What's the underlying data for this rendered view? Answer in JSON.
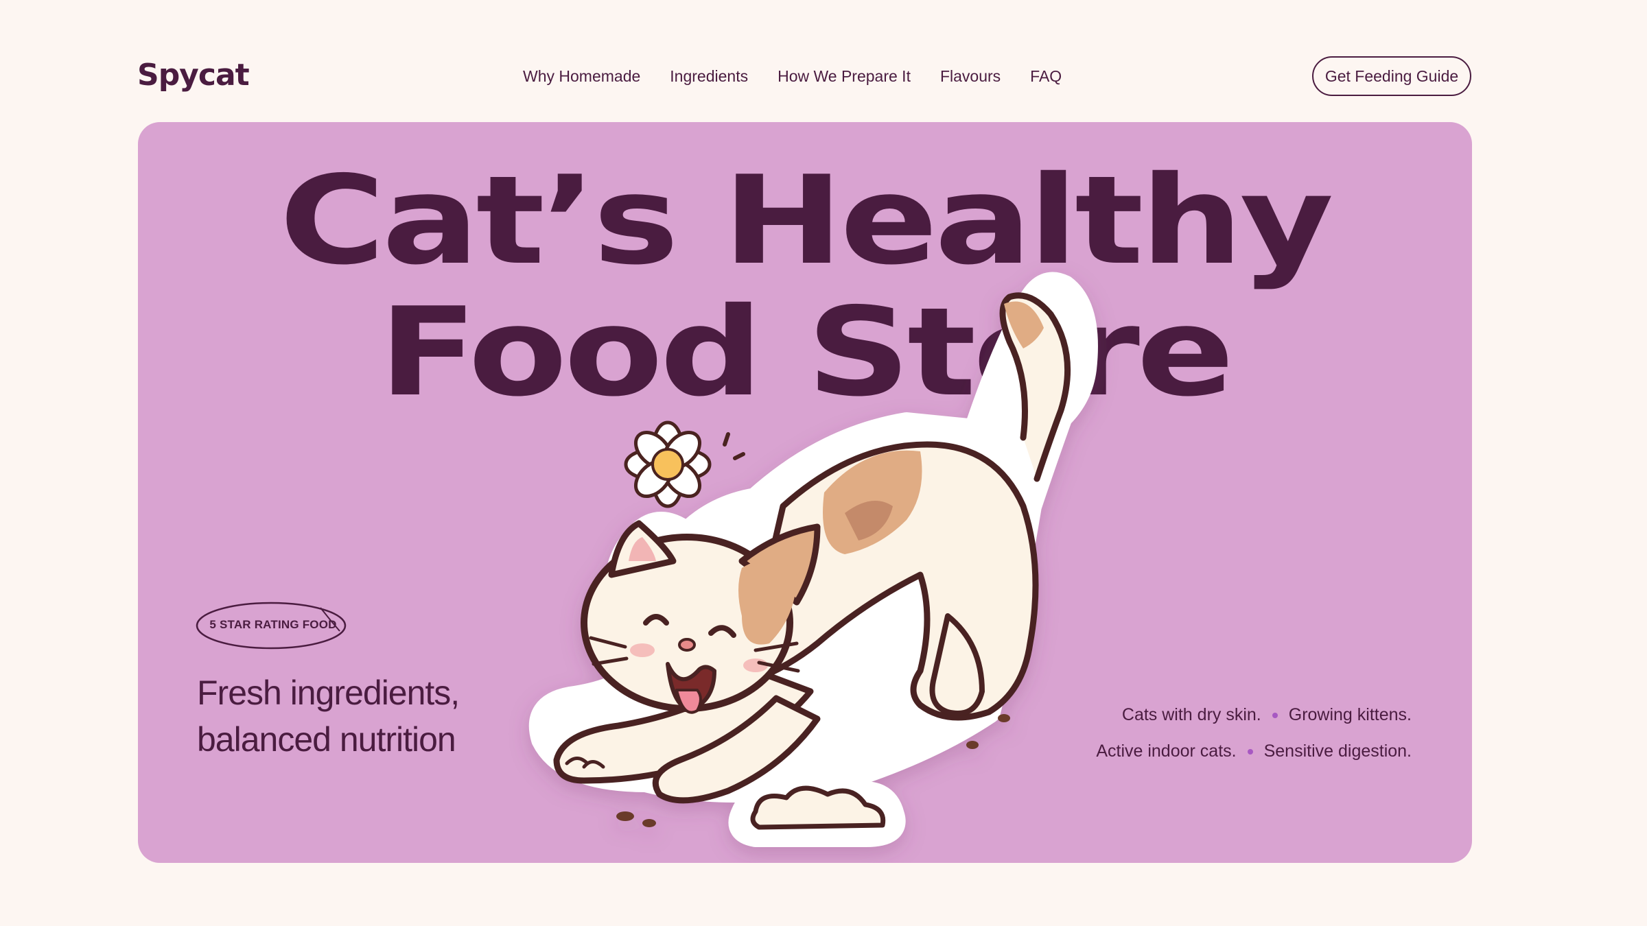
{
  "brand": {
    "logo": "Spycat"
  },
  "nav": {
    "items": [
      "Why Homemade",
      "Ingredients",
      "How We Prepare It",
      "Flavours",
      "FAQ"
    ]
  },
  "header": {
    "cta_label": "Get Feeding Guide"
  },
  "hero": {
    "headline_line1": "Cat’s Healthy",
    "headline_line2": "Food Store",
    "rating_badge": "5 STAR RATING FOOD",
    "tagline": "Fresh ingredients, balanced nutrition",
    "benefits_row1": [
      "Cats with dry skin.",
      "Growing kittens."
    ],
    "benefits_row2": [
      "Active indoor cats.",
      "Sensitive digestion."
    ],
    "illustration": "happy-cat-stretching-with-flower"
  },
  "colors": {
    "page_bg": "#fdf6f2",
    "hero_bg": "#d9a3d1",
    "text_dark": "#4a1c40",
    "bullet": "#a758c2"
  }
}
